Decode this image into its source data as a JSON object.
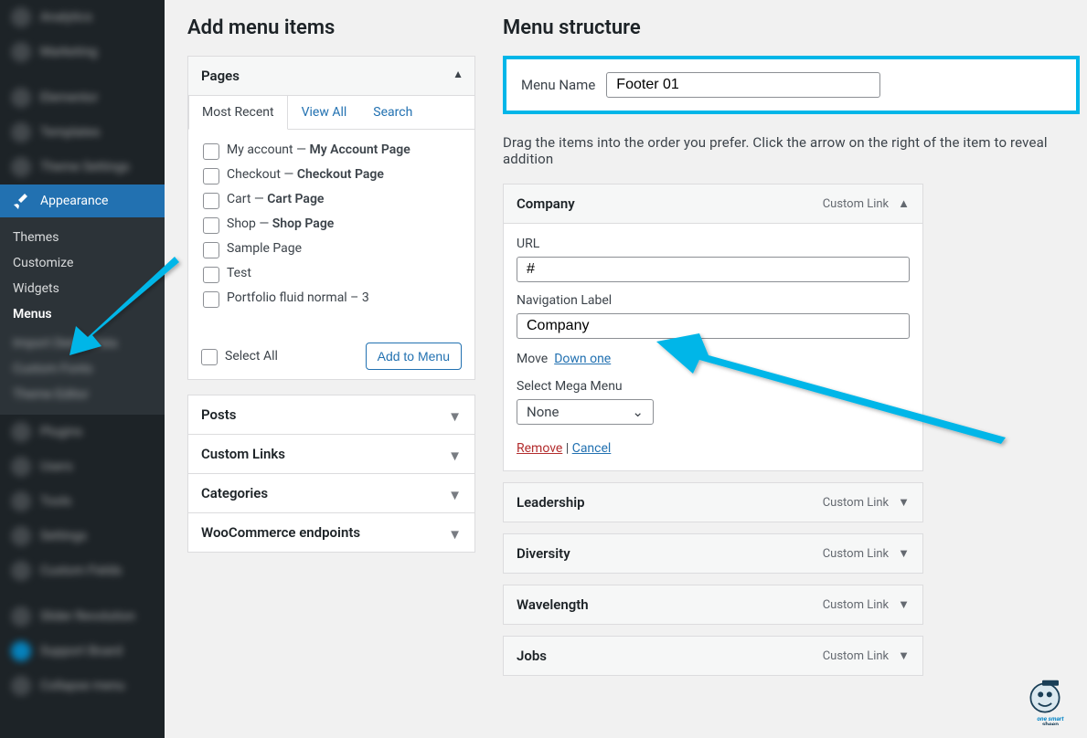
{
  "sidebar": {
    "blurred": [
      "Analytics",
      "Marketing",
      "Elementor",
      "Templates",
      "Theme Settings"
    ],
    "active": {
      "label": "Appearance"
    },
    "sub": [
      "Themes",
      "Customize",
      "Widgets",
      "Menus"
    ],
    "sub_current": "Menus",
    "blurred2": [
      "Import Demo Data",
      "Custom Fonts",
      "Theme Editor",
      "Plugins",
      "Users",
      "Tools",
      "Settings",
      "Custom Fields",
      "",
      "Slider Revolution",
      "Support Board",
      "Collapse menu"
    ]
  },
  "left": {
    "heading": "Add menu items",
    "pages": {
      "title": "Pages",
      "tabs": {
        "most_recent": "Most Recent",
        "view_all": "View All",
        "search": "Search"
      },
      "items": [
        {
          "pre": "My account — ",
          "strong": "My Account Page"
        },
        {
          "pre": "Checkout — ",
          "strong": "Checkout Page"
        },
        {
          "pre": "Cart — ",
          "strong": "Cart Page"
        },
        {
          "pre": "Shop — ",
          "strong": "Shop Page"
        },
        {
          "pre": "Sample Page",
          "strong": ""
        },
        {
          "pre": "Test",
          "strong": ""
        },
        {
          "pre": "Portfolio fluid normal – 3",
          "strong": ""
        }
      ],
      "select_all": "Select All",
      "add_btn": "Add to Menu"
    },
    "collapsed": [
      "Posts",
      "Custom Links",
      "Categories",
      "WooCommerce endpoints"
    ]
  },
  "right": {
    "heading": "Menu structure",
    "name_label": "Menu Name",
    "name_value": "Footer 01",
    "instruction": "Drag the items into the order you prefer. Click the arrow on the right of the item to reveal addition",
    "type_label": "Custom Link",
    "items": [
      {
        "label": "Company",
        "expanded": true,
        "url_label": "URL",
        "url_value": "#",
        "nav_label_label": "Navigation Label",
        "nav_label_value": "Company",
        "move_label": "Move",
        "move_link": "Down one",
        "mm_label": "Select Mega Menu",
        "mm_value": "None",
        "remove": "Remove",
        "cancel": "Cancel"
      },
      {
        "label": "Leadership"
      },
      {
        "label": "Diversity"
      },
      {
        "label": "Wavelength"
      },
      {
        "label": "Jobs"
      }
    ]
  },
  "logo_text": {
    "line1": "one smart",
    "line2": "sheep"
  }
}
